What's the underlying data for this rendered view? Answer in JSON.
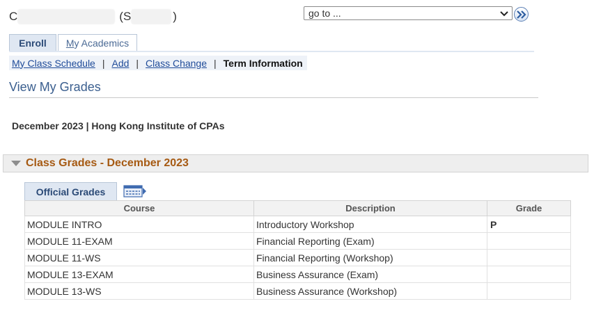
{
  "header": {
    "name_initial": "C",
    "id_prefix": "(S",
    "id_suffix": ")"
  },
  "goto": {
    "value": "go to ...",
    "go_icon": "double-chevron-right-icon"
  },
  "tabs": [
    {
      "label": "Enroll",
      "active": true
    },
    {
      "label_first": "M",
      "label_rest": "y Academics",
      "active": false
    }
  ],
  "subnav": {
    "items": [
      {
        "first": "M",
        "rest": "y Class Schedule"
      },
      {
        "first": "A",
        "rest": "dd"
      },
      {
        "first": "C",
        "rest": "lass Change"
      }
    ],
    "separator": "|",
    "current": "Term Information"
  },
  "page_title": "View My Grades",
  "term_label": "December 2023 | Hong Kong Institute of CPAs",
  "section": {
    "title": "Class Grades - December 2023",
    "icon": "collapse-triangle-icon"
  },
  "grid": {
    "tab_label": "Official Grades",
    "view_icon": "show-all-columns-icon",
    "columns": [
      "Course",
      "Description",
      "Grade"
    ],
    "rows": [
      {
        "course": "MODULE INTRO",
        "description": "Introductory Workshop",
        "grade": "P"
      },
      {
        "course": "MODULE 11-EXAM",
        "description": "Financial Reporting (Exam)",
        "grade": ""
      },
      {
        "course": "MODULE 11-WS",
        "description": "Financial Reporting (Workshop)",
        "grade": ""
      },
      {
        "course": "MODULE 13-EXAM",
        "description": "Business Assurance (Exam)",
        "grade": ""
      },
      {
        "course": "MODULE 13-WS",
        "description": "Business Assurance (Workshop)",
        "grade": ""
      }
    ]
  }
}
